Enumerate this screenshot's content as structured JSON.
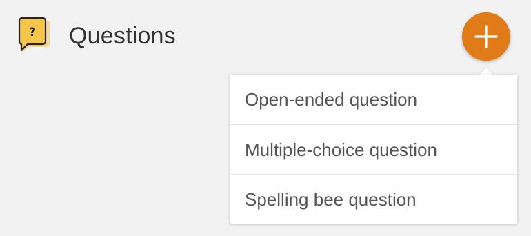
{
  "header": {
    "title": "Questions",
    "icon": "question-speech-bubble-icon",
    "icon_glyph": "?"
  },
  "add_button": {
    "icon": "plus-icon",
    "color": "#e07b17"
  },
  "menu": {
    "items": [
      {
        "label": "Open-ended question"
      },
      {
        "label": "Multiple-choice question"
      },
      {
        "label": "Spelling bee question"
      }
    ]
  },
  "colors": {
    "accent": "#e07b17",
    "icon_fill": "#f7c54a",
    "background": "#f2f2f2"
  }
}
